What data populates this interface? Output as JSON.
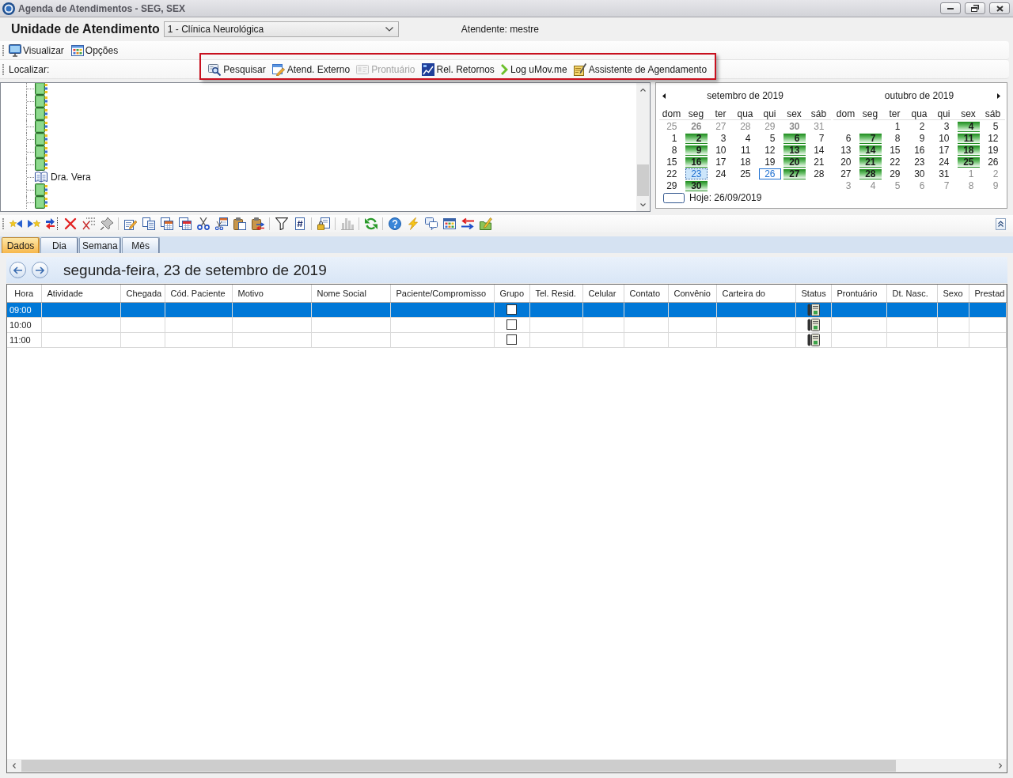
{
  "window": {
    "title": "Agenda de Atendimentos - SEG, SEX"
  },
  "header": {
    "unit_label": "Unidade de Atendimento",
    "unit_select": {
      "value": "1 - Clínica Neurológica"
    },
    "attendant": "Atendente: mestre"
  },
  "menu": [
    {
      "kind": "view",
      "label": "Visualizar"
    },
    {
      "kind": "options",
      "label": "Opções"
    }
  ],
  "search_bar": {
    "label": "Localizar:",
    "highlighted": true,
    "actions": [
      {
        "kind": "search",
        "label": "Pesquisar",
        "disabled": false
      },
      {
        "kind": "external",
        "label": "Atend. Externo",
        "disabled": false
      },
      {
        "kind": "record",
        "label": "Prontuário",
        "disabled": true
      },
      {
        "kind": "report",
        "label": "Rel. Retornos",
        "disabled": false
      },
      {
        "kind": "log",
        "label": "Log uMov.me",
        "disabled": false
      },
      {
        "kind": "wizard",
        "label": "Assistente de Agendamento",
        "disabled": false
      }
    ]
  },
  "tree": {
    "items": [
      {
        "kind": "closed"
      },
      {
        "kind": "closed"
      },
      {
        "kind": "closed"
      },
      {
        "kind": "closed"
      },
      {
        "kind": "closed"
      },
      {
        "kind": "closed"
      },
      {
        "kind": "closed"
      },
      {
        "kind": "open",
        "label": "Dra. Vera"
      },
      {
        "kind": "closed"
      },
      {
        "kind": "closed"
      }
    ]
  },
  "calendar": {
    "months": [
      {
        "title": "setembro de 2019",
        "weekdays": [
          "dom",
          "seg",
          "ter",
          "qua",
          "qui",
          "sex",
          "sáb"
        ],
        "weeks": [
          [
            {
              "day": "25",
              "outside": true,
              "busy": false,
              "selected": false,
              "today": false
            },
            {
              "day": "26",
              "outside": true,
              "busy": true,
              "selected": false,
              "today": false
            },
            {
              "day": "27",
              "outside": true,
              "busy": false,
              "selected": false,
              "today": false
            },
            {
              "day": "28",
              "outside": true,
              "busy": false,
              "selected": false,
              "today": false
            },
            {
              "day": "29",
              "outside": true,
              "busy": false,
              "selected": false,
              "today": false
            },
            {
              "day": "30",
              "outside": true,
              "busy": true,
              "selected": false,
              "today": false
            },
            {
              "day": "31",
              "outside": true,
              "busy": false,
              "selected": false,
              "today": false
            }
          ],
          [
            {
              "day": "1",
              "outside": false,
              "busy": false,
              "selected": false,
              "today": false
            },
            {
              "day": "2",
              "outside": false,
              "busy": true,
              "selected": false,
              "today": false
            },
            {
              "day": "3",
              "outside": false,
              "busy": false,
              "selected": false,
              "today": false
            },
            {
              "day": "4",
              "outside": false,
              "busy": false,
              "selected": false,
              "today": false
            },
            {
              "day": "5",
              "outside": false,
              "busy": false,
              "selected": false,
              "today": false
            },
            {
              "day": "6",
              "outside": false,
              "busy": true,
              "selected": false,
              "today": false
            },
            {
              "day": "7",
              "outside": false,
              "busy": false,
              "selected": false,
              "today": false
            }
          ],
          [
            {
              "day": "8",
              "outside": false,
              "busy": false,
              "selected": false,
              "today": false
            },
            {
              "day": "9",
              "outside": false,
              "busy": true,
              "selected": false,
              "today": false
            },
            {
              "day": "10",
              "outside": false,
              "busy": false,
              "selected": false,
              "today": false
            },
            {
              "day": "11",
              "outside": false,
              "busy": false,
              "selected": false,
              "today": false
            },
            {
              "day": "12",
              "outside": false,
              "busy": false,
              "selected": false,
              "today": false
            },
            {
              "day": "13",
              "outside": false,
              "busy": true,
              "selected": false,
              "today": false
            },
            {
              "day": "14",
              "outside": false,
              "busy": false,
              "selected": false,
              "today": false
            }
          ],
          [
            {
              "day": "15",
              "outside": false,
              "busy": false,
              "selected": false,
              "today": false
            },
            {
              "day": "16",
              "outside": false,
              "busy": true,
              "selected": false,
              "today": false
            },
            {
              "day": "17",
              "outside": false,
              "busy": false,
              "selected": false,
              "today": false
            },
            {
              "day": "18",
              "outside": false,
              "busy": false,
              "selected": false,
              "today": false
            },
            {
              "day": "19",
              "outside": false,
              "busy": false,
              "selected": false,
              "today": false
            },
            {
              "day": "20",
              "outside": false,
              "busy": true,
              "selected": false,
              "today": false
            },
            {
              "day": "21",
              "outside": false,
              "busy": false,
              "selected": false,
              "today": false
            }
          ],
          [
            {
              "day": "22",
              "outside": false,
              "busy": false,
              "selected": false,
              "today": false
            },
            {
              "day": "23",
              "outside": false,
              "busy": false,
              "selected": true,
              "today": false
            },
            {
              "day": "24",
              "outside": false,
              "busy": false,
              "selected": false,
              "today": false
            },
            {
              "day": "25",
              "outside": false,
              "busy": false,
              "selected": false,
              "today": false
            },
            {
              "day": "26",
              "outside": false,
              "busy": false,
              "selected": false,
              "today": true
            },
            {
              "day": "27",
              "outside": false,
              "busy": true,
              "selected": false,
              "today": false
            },
            {
              "day": "28",
              "outside": false,
              "busy": false,
              "selected": false,
              "today": false
            }
          ],
          [
            {
              "day": "29",
              "outside": false,
              "busy": false,
              "selected": false,
              "today": false
            },
            {
              "day": "30",
              "outside": false,
              "busy": true,
              "selected": false,
              "today": false
            }
          ]
        ]
      },
      {
        "title": "outubro de 2019",
        "weekdays": [
          "dom",
          "seg",
          "ter",
          "qua",
          "qui",
          "sex",
          "sáb"
        ],
        "weeks": [
          [
            {
              "day": "1",
              "outside": false,
              "busy": false,
              "selected": false,
              "today": false
            },
            {
              "day": "2",
              "outside": false,
              "busy": false,
              "selected": false,
              "today": false
            },
            {
              "day": "3",
              "outside": false,
              "busy": false,
              "selected": false,
              "today": false
            },
            {
              "day": "4",
              "outside": false,
              "busy": true,
              "selected": false,
              "today": false
            },
            {
              "day": "5",
              "outside": false,
              "busy": false,
              "selected": false,
              "today": false
            }
          ],
          [
            {
              "day": "6",
              "outside": false,
              "busy": false,
              "selected": false,
              "today": false
            },
            {
              "day": "7",
              "outside": false,
              "busy": true,
              "selected": false,
              "today": false
            },
            {
              "day": "8",
              "outside": false,
              "busy": false,
              "selected": false,
              "today": false
            },
            {
              "day": "9",
              "outside": false,
              "busy": false,
              "selected": false,
              "today": false
            },
            {
              "day": "10",
              "outside": false,
              "busy": false,
              "selected": false,
              "today": false
            },
            {
              "day": "11",
              "outside": false,
              "busy": true,
              "selected": false,
              "today": false
            },
            {
              "day": "12",
              "outside": false,
              "busy": false,
              "selected": false,
              "today": false
            }
          ],
          [
            {
              "day": "13",
              "outside": false,
              "busy": false,
              "selected": false,
              "today": false
            },
            {
              "day": "14",
              "outside": false,
              "busy": true,
              "selected": false,
              "today": false
            },
            {
              "day": "15",
              "outside": false,
              "busy": false,
              "selected": false,
              "today": false
            },
            {
              "day": "16",
              "outside": false,
              "busy": false,
              "selected": false,
              "today": false
            },
            {
              "day": "17",
              "outside": false,
              "busy": false,
              "selected": false,
              "today": false
            },
            {
              "day": "18",
              "outside": false,
              "busy": true,
              "selected": false,
              "today": false
            },
            {
              "day": "19",
              "outside": false,
              "busy": false,
              "selected": false,
              "today": false
            }
          ],
          [
            {
              "day": "20",
              "outside": false,
              "busy": false,
              "selected": false,
              "today": false
            },
            {
              "day": "21",
              "outside": false,
              "busy": true,
              "selected": false,
              "today": false
            },
            {
              "day": "22",
              "outside": false,
              "busy": false,
              "selected": false,
              "today": false
            },
            {
              "day": "23",
              "outside": false,
              "busy": false,
              "selected": false,
              "today": false
            },
            {
              "day": "24",
              "outside": false,
              "busy": false,
              "selected": false,
              "today": false
            },
            {
              "day": "25",
              "outside": false,
              "busy": true,
              "selected": false,
              "today": false
            },
            {
              "day": "26",
              "outside": false,
              "busy": false,
              "selected": false,
              "today": false
            }
          ],
          [
            {
              "day": "27",
              "outside": false,
              "busy": false,
              "selected": false,
              "today": false
            },
            {
              "day": "28",
              "outside": false,
              "busy": true,
              "selected": false,
              "today": false
            },
            {
              "day": "29",
              "outside": false,
              "busy": false,
              "selected": false,
              "today": false
            },
            {
              "day": "30",
              "outside": false,
              "busy": false,
              "selected": false,
              "today": false
            },
            {
              "day": "31",
              "outside": false,
              "busy": false,
              "selected": false,
              "today": false
            },
            {
              "day": "1",
              "outside": true,
              "busy": false,
              "selected": false,
              "today": false
            },
            {
              "day": "2",
              "outside": true,
              "busy": false,
              "selected": false,
              "today": false
            }
          ],
          [
            {
              "day": "3",
              "outside": true,
              "busy": false,
              "selected": false,
              "today": false
            },
            {
              "day": "4",
              "outside": true,
              "busy": false,
              "selected": false,
              "today": false
            },
            {
              "day": "5",
              "outside": true,
              "busy": false,
              "selected": false,
              "today": false
            },
            {
              "day": "6",
              "outside": true,
              "busy": false,
              "selected": false,
              "today": false
            },
            {
              "day": "7",
              "outside": true,
              "busy": false,
              "selected": false,
              "today": false
            },
            {
              "day": "8",
              "outside": true,
              "busy": false,
              "selected": false,
              "today": false
            },
            {
              "day": "9",
              "outside": true,
              "busy": false,
              "selected": false,
              "today": false
            }
          ]
        ]
      }
    ],
    "today_label": "Hoje: 26/09/2019"
  },
  "toolbar": {
    "groups": [
      [
        {
          "kind": "mark-back",
          "disabled": false
        },
        {
          "kind": "mark-forward",
          "disabled": false
        },
        {
          "kind": "move",
          "disabled": false
        },
        {
          "kind": "delete",
          "disabled": false
        },
        {
          "kind": "clear",
          "disabled": false
        },
        {
          "kind": "pin",
          "disabled": false
        }
      ],
      [
        {
          "kind": "edit",
          "disabled": false
        },
        {
          "kind": "copy",
          "disabled": false
        },
        {
          "kind": "copy-calendar",
          "disabled": false
        },
        {
          "kind": "copy-calendar-alt",
          "disabled": false
        },
        {
          "kind": "cut",
          "disabled": false
        },
        {
          "kind": "cut-calendar",
          "disabled": false
        },
        {
          "kind": "paste",
          "disabled": false
        },
        {
          "kind": "paste-special",
          "disabled": false
        }
      ],
      [
        {
          "kind": "filter",
          "disabled": false
        },
        {
          "kind": "number",
          "disabled": false
        }
      ],
      [
        {
          "kind": "lock",
          "disabled": false
        }
      ],
      [
        {
          "kind": "chart",
          "disabled": true
        }
      ],
      [
        {
          "kind": "refresh",
          "disabled": false
        }
      ],
      [
        {
          "kind": "help",
          "disabled": false
        },
        {
          "kind": "flash",
          "disabled": false
        },
        {
          "kind": "chat",
          "disabled": false
        },
        {
          "kind": "grid",
          "disabled": false
        },
        {
          "kind": "swap",
          "disabled": false
        },
        {
          "kind": "folder-edit",
          "disabled": false
        }
      ]
    ]
  },
  "view_tabs": [
    {
      "label": "Dados",
      "selected": true
    },
    {
      "label": "Dia",
      "selected": false
    },
    {
      "label": "Semana",
      "selected": false
    },
    {
      "label": "Mês",
      "selected": false
    }
  ],
  "day_view": {
    "title": "segunda-feira, 23 de setembro de 2019",
    "table": {
      "columns": [
        "Hora",
        "Atividade",
        "Chegada",
        "Cód. Paciente",
        "Motivo",
        "Nome Social",
        "Paciente/Compromisso",
        "Grupo",
        "Tel. Resid.",
        "Celular",
        "Contato",
        "Convênio",
        "Carteira do",
        "Status",
        "Prontuário",
        "Dt. Nasc.",
        "Sexo",
        "Prestad"
      ],
      "rows": [
        {
          "time": "09:00",
          "selected": true,
          "group_checked": false
        },
        {
          "time": "10:00",
          "selected": false,
          "group_checked": false
        },
        {
          "time": "11:00",
          "selected": false,
          "group_checked": false
        }
      ]
    }
  }
}
